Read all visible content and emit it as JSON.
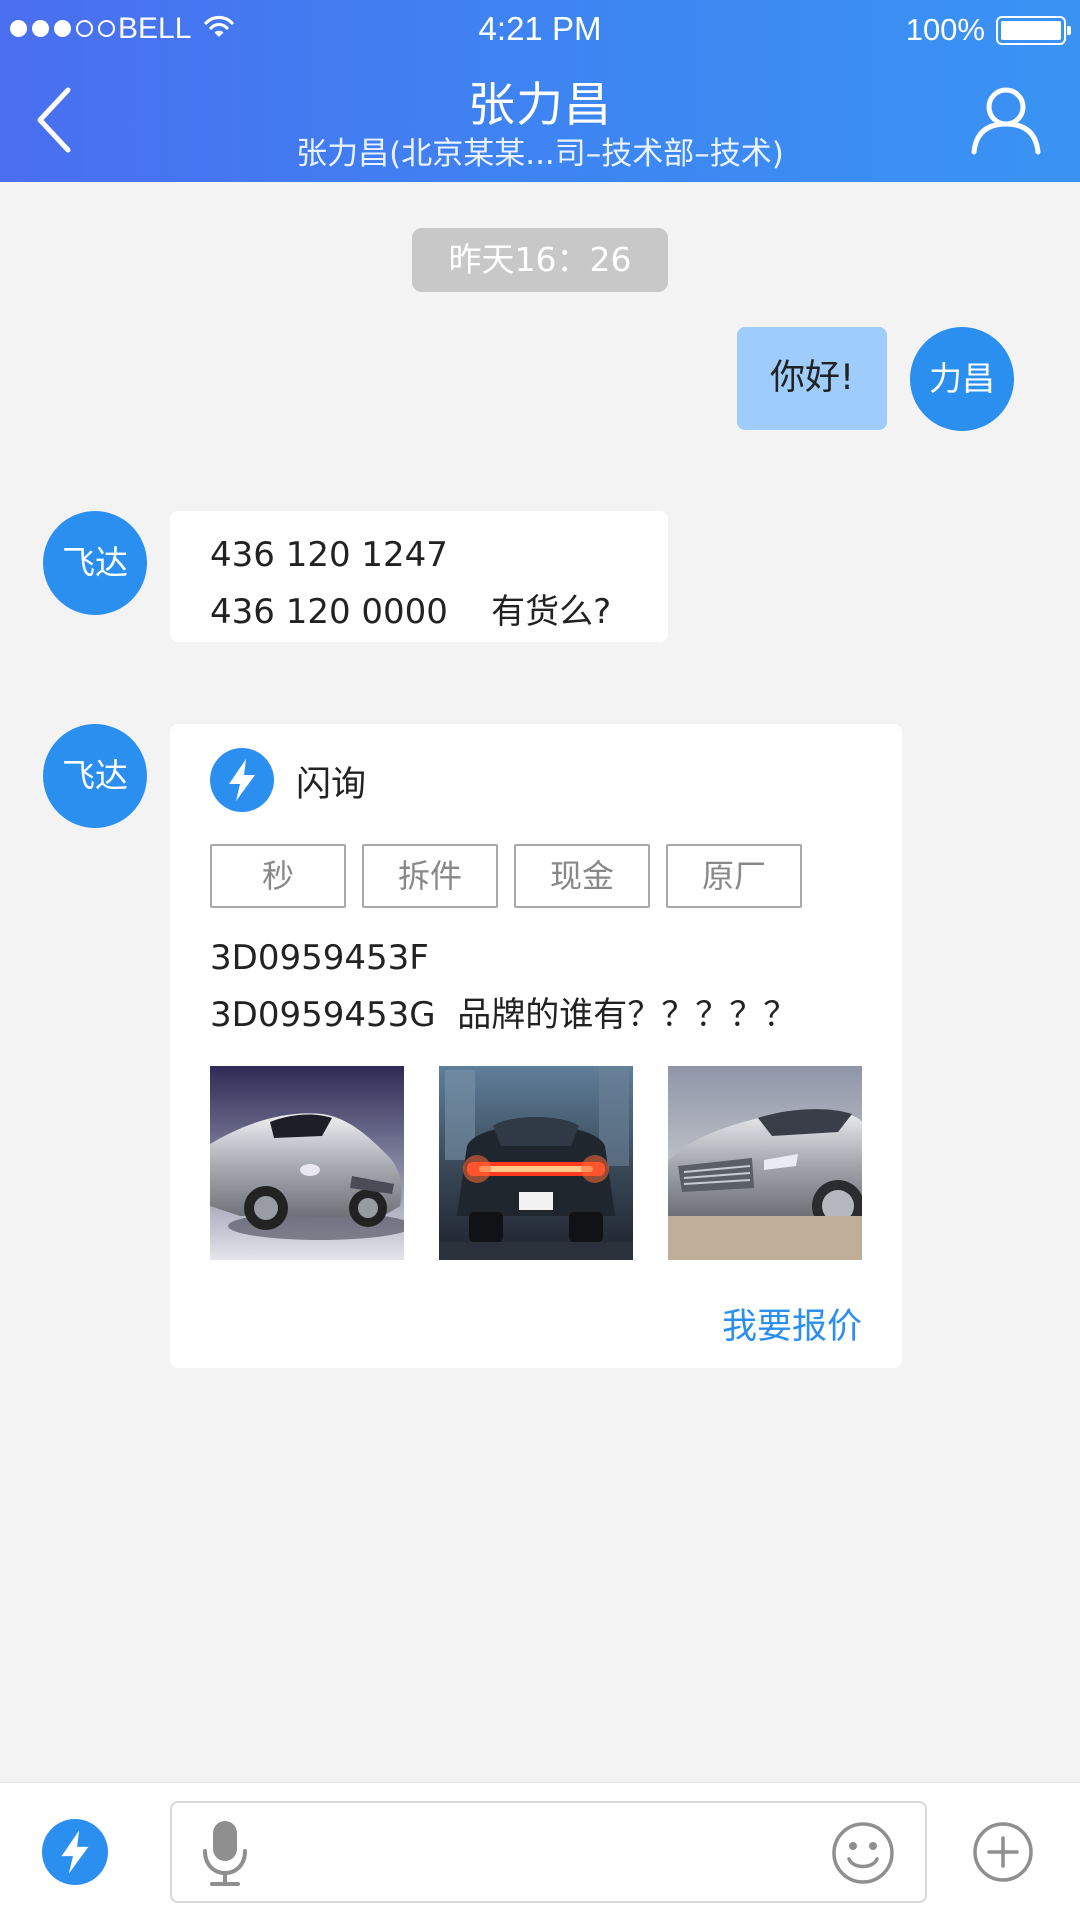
{
  "status_bar": {
    "carrier": "BELL",
    "time": "4:21 PM",
    "battery": "100%",
    "signal_dots_filled": 3,
    "signal_dots_total": 5
  },
  "header": {
    "title": "张力昌",
    "subtitle": "张力昌(北京某某...司–技术部–技术)",
    "back_icon": "chevron-left-icon",
    "contact_icon": "person-icon"
  },
  "chat": {
    "timestamp": "昨天16：26",
    "messages": [
      {
        "direction": "out",
        "avatar": "力昌",
        "text": "你好!"
      },
      {
        "direction": "in",
        "avatar": "飞达",
        "lines": [
          "436 120 1247",
          "436 120 0000    有货么?"
        ]
      },
      {
        "direction": "in",
        "avatar": "飞达",
        "card": {
          "icon": "lightning-icon",
          "title": "闪询",
          "tags": [
            "秒",
            "拆件",
            "现金",
            "原厂"
          ],
          "lines": [
            "3D0959453F",
            "3D0959453G  品牌的谁有？？？？？"
          ],
          "images": [
            "silver-sports-car-image",
            "car-rear-taillights-image",
            "silver-coupe-front-image"
          ],
          "action": "我要报价"
        }
      }
    ]
  },
  "input_bar": {
    "left_icon": "lightning-icon",
    "voice_icon": "microphone-icon",
    "emoji_icon": "smiley-icon",
    "more_icon": "plus-circle-icon"
  },
  "colors": {
    "header_start": "#4a6ef0",
    "header_end": "#3a93f3",
    "accent": "#2b8ff0",
    "outgoing_bubble": "#9fcdfb",
    "background": "#f3f3f3"
  }
}
